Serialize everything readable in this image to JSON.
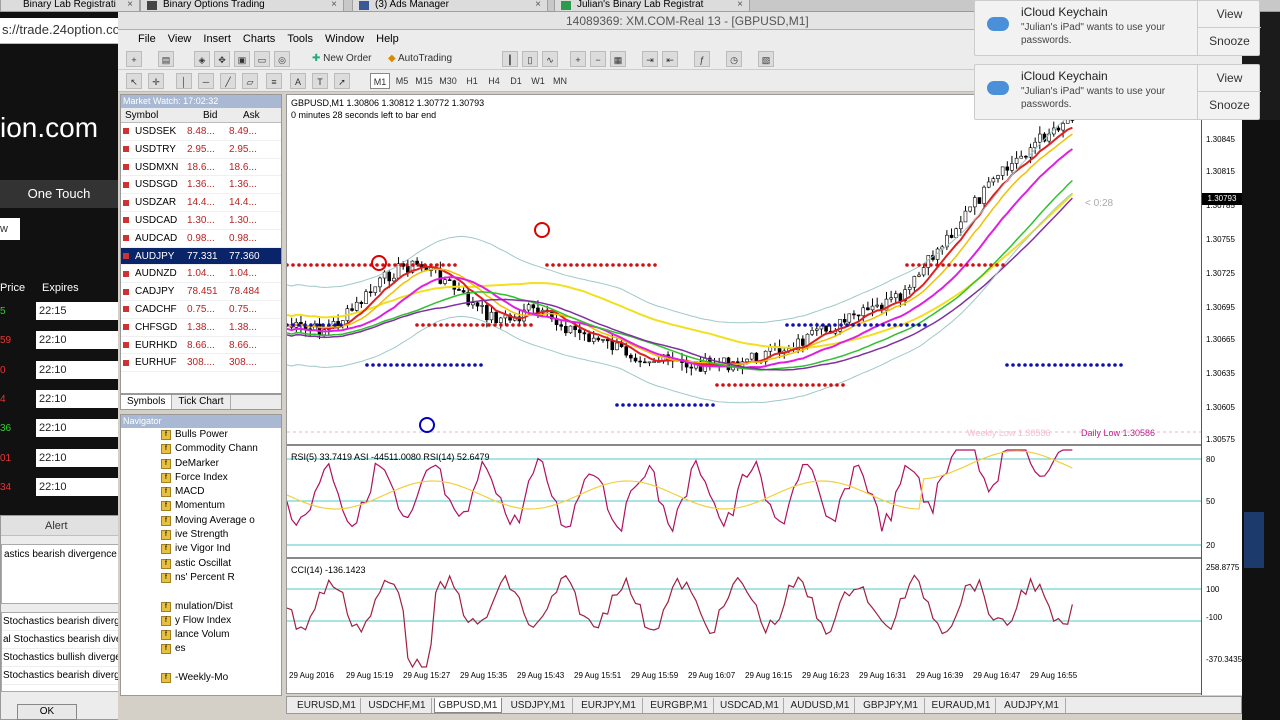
{
  "browser_tabs": [
    {
      "label": "Binary Lab Registrati",
      "close": "×"
    },
    {
      "label": "Binary Options Trading",
      "close": "×"
    },
    {
      "label": "(3) Ads Manager",
      "close": "×"
    },
    {
      "label": "Julian's Binary Lab Registrat",
      "close": "×"
    }
  ],
  "webpage": {
    "url": "s://trade.24option.co",
    "brand": "ion.com",
    "one_touch": "One Touch",
    "button": "w",
    "col_price": "Price",
    "col_expires": "Expires",
    "rows": [
      {
        "price": "5",
        "expires": "22:15",
        "color": "#3c3"
      },
      {
        "price": "59",
        "expires": "22:10",
        "color": "#e33"
      },
      {
        "price": "0",
        "expires": "22:10",
        "color": "#e33"
      },
      {
        "price": "4",
        "expires": "22:10",
        "color": "#e33"
      },
      {
        "price": "36",
        "expires": "22:10",
        "color": "#3c3"
      },
      {
        "price": "01",
        "expires": "22:10",
        "color": "#e33"
      },
      {
        "price": "34",
        "expires": "22:10",
        "color": "#e33"
      }
    ]
  },
  "alert": {
    "title": "Alert",
    "message": "astics bearish divergence on: USDCHF , 1 mi",
    "items": [
      "Stochastics bearish divergence on: USDC...",
      "al Stochastics bearish divergence on: EUR...",
      "Stochastics bullish divergence on: EURUS...",
      "Stochastics bearish divergence on: USDJ..."
    ],
    "ok": "OK"
  },
  "mt4": {
    "title": "14089369: XM.COM-Real 13 - [GBPUSD,M1]",
    "menu": [
      "File",
      "View",
      "Insert",
      "Charts",
      "Tools",
      "Window",
      "Help"
    ],
    "new_order": "New Order",
    "auto_trading": "AutoTrading",
    "timeframes": [
      "M1",
      "M5",
      "M15",
      "M30",
      "H1",
      "H4",
      "D1",
      "W1",
      "MN"
    ]
  },
  "market_watch": {
    "title": "Market Watch: 17:02:32",
    "col_symbol": "Symbol",
    "col_bid": "Bid",
    "col_ask": "Ask",
    "rows": [
      {
        "symbol": "USDSEK",
        "bid": "8.48...",
        "ask": "8.49..."
      },
      {
        "symbol": "USDTRY",
        "bid": "2.95...",
        "ask": "2.95..."
      },
      {
        "symbol": "USDMXN",
        "bid": "18.6...",
        "ask": "18.6..."
      },
      {
        "symbol": "USDSGD",
        "bid": "1.36...",
        "ask": "1.36..."
      },
      {
        "symbol": "USDZAR",
        "bid": "14.4...",
        "ask": "14.4..."
      },
      {
        "symbol": "USDCAD",
        "bid": "1.30...",
        "ask": "1.30..."
      },
      {
        "symbol": "AUDCAD",
        "bid": "0.98...",
        "ask": "0.98..."
      },
      {
        "symbol": "AUDJPY",
        "bid": "77.331",
        "ask": "77.360"
      },
      {
        "symbol": "AUDNZD",
        "bid": "1.04...",
        "ask": "1.04..."
      },
      {
        "symbol": "CADJPY",
        "bid": "78.451",
        "ask": "78.484"
      },
      {
        "symbol": "CADCHF",
        "bid": "0.75...",
        "ask": "0.75..."
      },
      {
        "symbol": "CHFSGD",
        "bid": "1.38...",
        "ask": "1.38..."
      },
      {
        "symbol": "EURHKD",
        "bid": "8.66...",
        "ask": "8.66..."
      },
      {
        "symbol": "EURHUF",
        "bid": "308....",
        "ask": "308...."
      }
    ],
    "tab_symbols": "Symbols",
    "tab_tick": "Tick Chart"
  },
  "navigator": {
    "title": "Navigator",
    "items": [
      "Bulls Power",
      "Commodity Chann",
      "DeMarker",
      "Force Index",
      "MACD",
      "Momentum",
      "Moving Average o",
      "ive Strength",
      "ive Vigor Ind",
      "astic Oscillat",
      "ns' Percent R",
      "",
      "mulation/Dist",
      "y Flow Index",
      "lance Volum",
      "es",
      "",
      "-Weekly-Mo"
    ]
  },
  "chart": {
    "info": "GBPUSD,M1  1.30806 1.30812 1.30772 1.30793",
    "time_left": "0 minutes 28 seconds left to bar end",
    "countdown": "< 0:28",
    "current_price": "1.30793",
    "price_ticks": [
      "1.30845",
      "1.30815",
      "1.30785",
      "1.30755",
      "1.30725",
      "1.30695",
      "1.30665",
      "1.30635",
      "1.30605",
      "1.30575"
    ],
    "weekly_low": "Weekly Low 1.30586",
    "daily_low": "Daily Low 1.30586",
    "rsi_label": "RSI(5) 33.7419  ASI -44511.0080  RSI(14) 52.6479",
    "rsi_ticks": [
      "80",
      "50",
      "20"
    ],
    "cci_label": "CCI(14) -136.1423",
    "cci_ticks": [
      "258.8775",
      "100",
      "-100",
      "-370.3435"
    ],
    "time_ticks": [
      "29 Aug 2016",
      "29 Aug 15:19",
      "29 Aug 15:27",
      "29 Aug 15:35",
      "29 Aug 15:43",
      "29 Aug 15:51",
      "29 Aug 15:59",
      "29 Aug 16:07",
      "29 Aug 16:15",
      "29 Aug 16:23",
      "29 Aug 16:31",
      "29 Aug 16:39",
      "29 Aug 16:47",
      "29 Aug 16:55"
    ]
  },
  "chart_tabs": [
    "EURUSD,M1",
    "USDCHF,M1",
    "GBPUSD,M1",
    "USDJPY,M1",
    "EURJPY,M1",
    "EURGBP,M1",
    "USDCAD,M1",
    "AUDUSD,M1",
    "GBPJPY,M1",
    "EURAUD,M1",
    "AUDJPY,M1"
  ],
  "notifications": [
    {
      "title": "iCloud Keychain",
      "body": "\"Julian's iPad\" wants to use your passwords.",
      "view": "View",
      "snooze": "Snooze"
    },
    {
      "title": "iCloud Keychain",
      "body": "\"Julian's iPad\" wants to use your passwords.",
      "view": "View",
      "snooze": "Snooze"
    }
  ]
}
